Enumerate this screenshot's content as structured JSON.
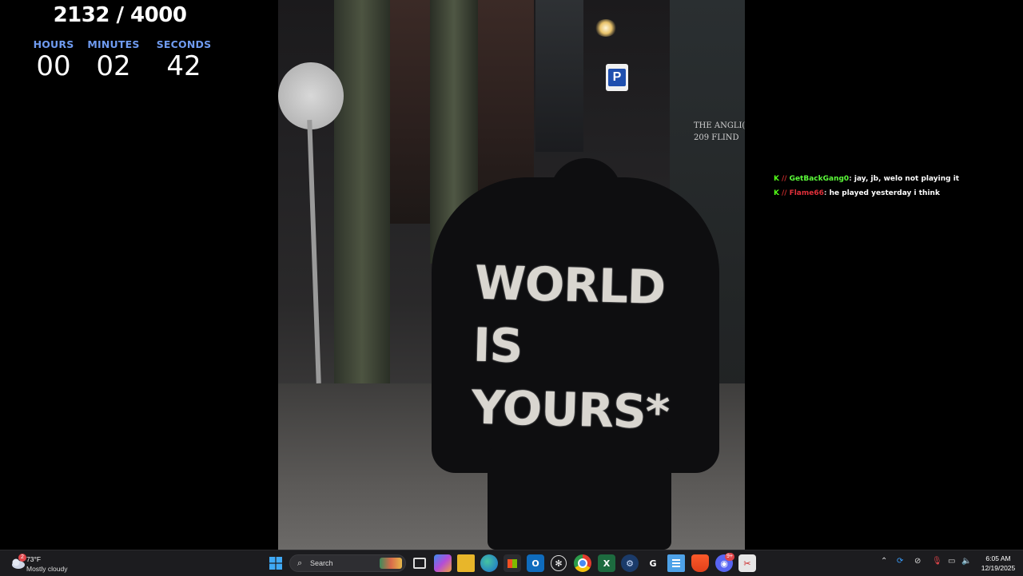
{
  "counter": {
    "title": "2132 / 4000"
  },
  "timer": {
    "hours_label": "HOURS",
    "hours": "00",
    "minutes_label": "MINUTES",
    "minutes": "02",
    "seconds_label": "SECONDS",
    "seconds": "42"
  },
  "photo": {
    "hoodie_text": [
      "WORLD",
      "IS",
      "YOURS*"
    ],
    "sign_lines": [
      "THE ANGLI(",
      "209 FLIND"
    ],
    "parking_sign": "P"
  },
  "chat": {
    "messages": [
      {
        "user": "GetBackGang0",
        "user_color": "#5cfc3a",
        "text": "jay, jb, welo not playing it"
      },
      {
        "user": "Flame66",
        "user_color": "#e0303a",
        "text": "he played yesterday i think"
      }
    ]
  },
  "taskbar": {
    "weather": {
      "temp": "73°F",
      "condition": "Mostly cloudy",
      "badge": "2"
    },
    "search_placeholder": "Search",
    "apps": [
      "start-icon",
      "search",
      "task-view-icon",
      "copilot-icon",
      "file-explorer-icon",
      "edge-icon",
      "store-icon",
      "outlook-icon",
      "chatgpt-icon",
      "chrome-icon",
      "excel-icon",
      "steam-icon",
      "app-g-icon",
      "notepad-icon",
      "brave-icon",
      "discord-icon",
      "snipping-tool-icon"
    ],
    "discord_badge": "9+",
    "clock": {
      "time": "6:05 AM",
      "date": "12/19/2025"
    }
  },
  "colors": {
    "timer_label": "#6f9bf0",
    "taskbar_bg": "#1c1c1f",
    "kick_green": "#53fc18"
  }
}
